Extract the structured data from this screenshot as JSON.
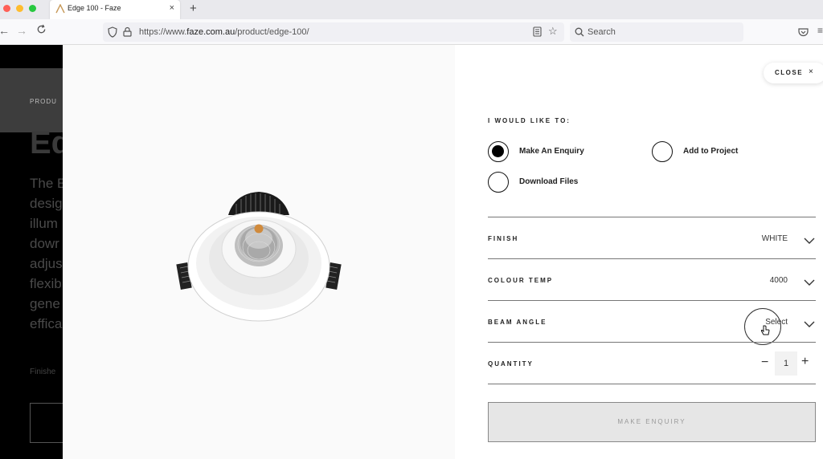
{
  "browser": {
    "tab_title": "Edge 100 - Faze",
    "url_scheme": "https://www.",
    "url_host": "faze.com.au",
    "url_path": "/product/edge-100/",
    "search_placeholder": "Search",
    "new_tab": "+",
    "tab_close": "×"
  },
  "background_page": {
    "breadcrumb": "PRODU",
    "title": "Ed",
    "description_lines": [
      "The E",
      "desig",
      "illum",
      "dowr",
      "adjus",
      "flexib",
      "gene",
      "effica"
    ],
    "finish_text": "Finishe"
  },
  "modal": {
    "close_label": "CLOSE",
    "close_x": "×",
    "heading": "I WOULD LIKE TO:",
    "options": [
      {
        "label": "Make An Enquiry",
        "selected": true
      },
      {
        "label": "Add to Project",
        "selected": false
      },
      {
        "label": "Download Files",
        "selected": false
      }
    ],
    "fields": [
      {
        "label": "FINISH",
        "value": "WHITE"
      },
      {
        "label": "COLOUR TEMP",
        "value": "4000"
      },
      {
        "label": "BEAM ANGLE",
        "value": "Select"
      }
    ],
    "quantity": {
      "label": "QUANTITY",
      "value": "1",
      "minus": "−",
      "plus": "+"
    },
    "submit_label": "MAKE ENQUIRY"
  },
  "colors": {
    "accent_dot": "#d08a3c",
    "panel_bg": "#fafafa"
  }
}
